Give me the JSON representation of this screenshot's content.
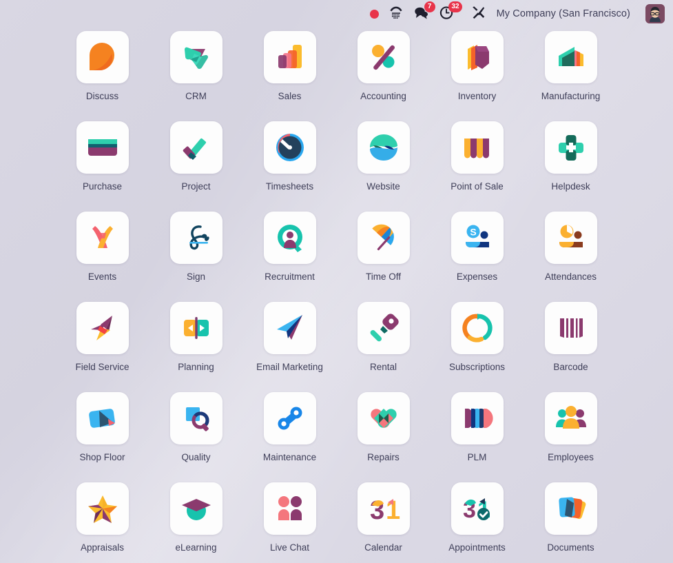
{
  "systray": {
    "recording_indicator": "recording-dot",
    "voip_icon": "phone-icon",
    "messages": {
      "icon": "chat-bubble-icon",
      "count": "7"
    },
    "activities": {
      "icon": "clock-icon",
      "count": "32"
    },
    "debug_icon": "tools-icon",
    "company": "My Company (San Francisco)",
    "avatar": "user-avatar"
  },
  "apps": [
    {
      "label": "Discuss",
      "icon": "discuss-icon"
    },
    {
      "label": "CRM",
      "icon": "crm-icon"
    },
    {
      "label": "Sales",
      "icon": "sales-icon"
    },
    {
      "label": "Accounting",
      "icon": "accounting-icon"
    },
    {
      "label": "Inventory",
      "icon": "inventory-icon"
    },
    {
      "label": "Manufacturing",
      "icon": "manufacturing-icon"
    },
    {
      "label": "Purchase",
      "icon": "purchase-icon"
    },
    {
      "label": "Project",
      "icon": "project-icon"
    },
    {
      "label": "Timesheets",
      "icon": "timesheets-icon"
    },
    {
      "label": "Website",
      "icon": "website-icon"
    },
    {
      "label": "Point of Sale",
      "icon": "point-of-sale-icon"
    },
    {
      "label": "Helpdesk",
      "icon": "helpdesk-icon"
    },
    {
      "label": "Events",
      "icon": "events-icon"
    },
    {
      "label": "Sign",
      "icon": "sign-icon"
    },
    {
      "label": "Recruitment",
      "icon": "recruitment-icon"
    },
    {
      "label": "Time Off",
      "icon": "time-off-icon"
    },
    {
      "label": "Expenses",
      "icon": "expenses-icon"
    },
    {
      "label": "Attendances",
      "icon": "attendances-icon"
    },
    {
      "label": "Field Service",
      "icon": "field-service-icon"
    },
    {
      "label": "Planning",
      "icon": "planning-icon"
    },
    {
      "label": "Email Marketing",
      "icon": "email-marketing-icon"
    },
    {
      "label": "Rental",
      "icon": "rental-icon"
    },
    {
      "label": "Subscriptions",
      "icon": "subscriptions-icon"
    },
    {
      "label": "Barcode",
      "icon": "barcode-icon"
    },
    {
      "label": "Shop Floor",
      "icon": "shop-floor-icon"
    },
    {
      "label": "Quality",
      "icon": "quality-icon"
    },
    {
      "label": "Maintenance",
      "icon": "maintenance-icon"
    },
    {
      "label": "Repairs",
      "icon": "repairs-icon"
    },
    {
      "label": "PLM",
      "icon": "plm-icon"
    },
    {
      "label": "Employees",
      "icon": "employees-icon"
    },
    {
      "label": "Appraisals",
      "icon": "appraisals-icon"
    },
    {
      "label": "eLearning",
      "icon": "elearning-icon"
    },
    {
      "label": "Live Chat",
      "icon": "live-chat-icon"
    },
    {
      "label": "Calendar",
      "icon": "calendar-icon"
    },
    {
      "label": "Appointments",
      "icon": "appointments-icon"
    },
    {
      "label": "Documents",
      "icon": "documents-icon"
    }
  ],
  "colors": {
    "badge_red": "#e8344a",
    "odoo_purple": "#875A7B",
    "teal": "#21c9a8",
    "orange": "#f5a623",
    "blue": "#2aa8f0",
    "text": "#3e3e58",
    "tile_bg": "#fdfdfd"
  }
}
